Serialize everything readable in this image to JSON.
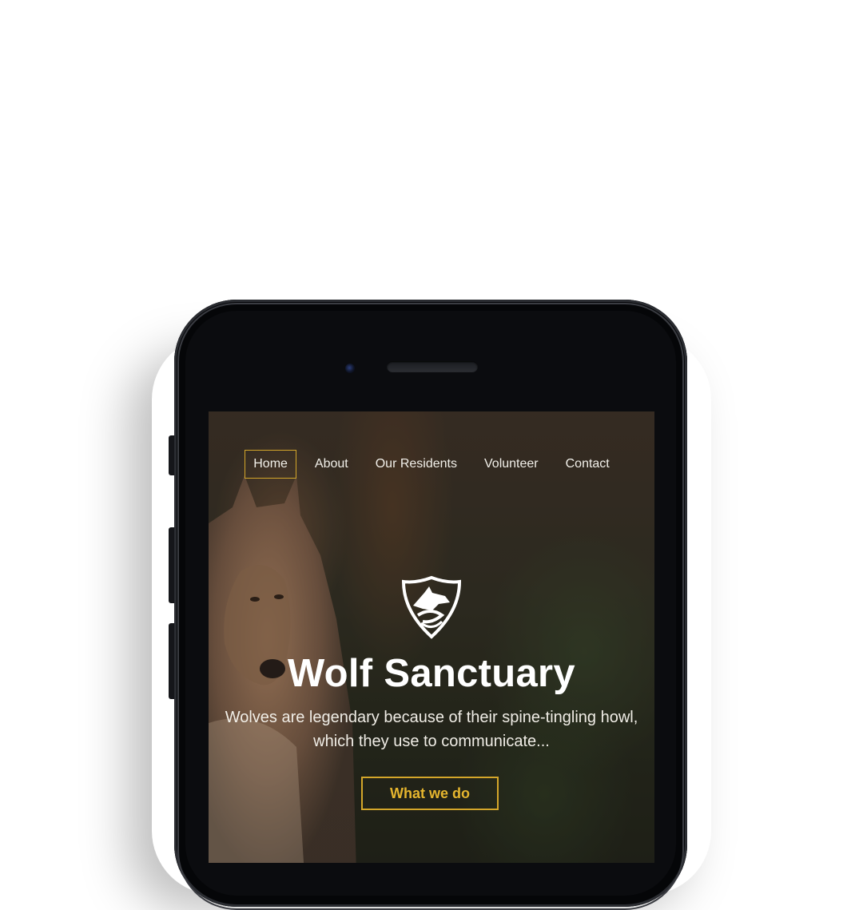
{
  "nav": {
    "items": [
      {
        "label": "Home",
        "active": true
      },
      {
        "label": "About"
      },
      {
        "label": "Our Residents"
      },
      {
        "label": "Volunteer"
      },
      {
        "label": "Contact"
      }
    ]
  },
  "hero": {
    "logo_icon": "wolf-shield-icon",
    "title": "Wolf Sanctuary",
    "tagline_line1": "Wolves are legendary because of their spine-tingling howl,",
    "tagline_line2": "which they use to communicate...",
    "cta_label": "What we do"
  },
  "colors": {
    "accent": "#d4a62a",
    "text": "#ffffff",
    "phone_body": "#0b0c0f"
  }
}
